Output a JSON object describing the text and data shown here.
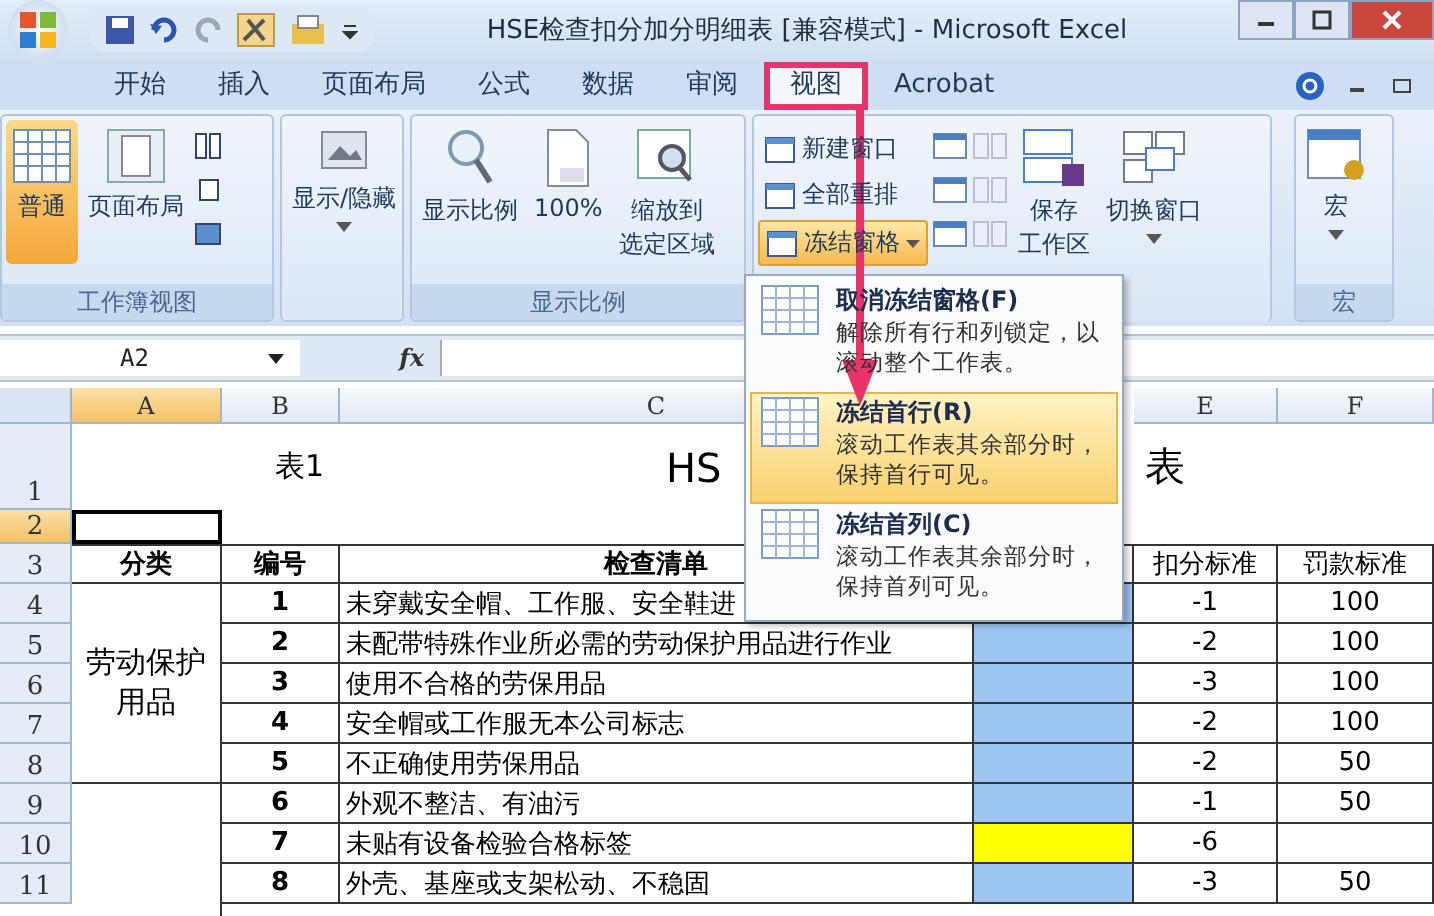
{
  "window": {
    "title": "HSE检查扣分加分明细表 [兼容模式] - Microsoft Excel"
  },
  "tabs": [
    {
      "label": "开始",
      "selected": false
    },
    {
      "label": "插入",
      "selected": false
    },
    {
      "label": "页面布局",
      "selected": false
    },
    {
      "label": "公式",
      "selected": false
    },
    {
      "label": "数据",
      "selected": false
    },
    {
      "label": "审阅",
      "selected": false
    },
    {
      "label": "视图",
      "selected": true
    },
    {
      "label": "Acrobat",
      "selected": false
    }
  ],
  "ribbon": {
    "workbook_views": {
      "label": "工作簿视图",
      "buttons": [
        {
          "label": "普通",
          "selected": true
        },
        {
          "label": "页面布局",
          "selected": false
        }
      ]
    },
    "show_hide": {
      "label": "显示/隐藏"
    },
    "zoom": {
      "label": "显示比例",
      "buttons": [
        {
          "lines": [
            "显示比例"
          ]
        },
        {
          "lines": [
            "100%"
          ]
        },
        {
          "lines": [
            "缩放到",
            "选定区域"
          ]
        }
      ]
    },
    "window_group": {
      "small": [
        {
          "label": "新建窗口",
          "expanded": false
        },
        {
          "label": "全部重排",
          "expanded": false
        },
        {
          "label": "冻结窗格",
          "expanded": true
        }
      ],
      "big": [
        {
          "lines": [
            "保存",
            "工作区"
          ]
        },
        {
          "lines": [
            "切换窗口"
          ]
        }
      ]
    },
    "macros": {
      "label": "宏",
      "button": "宏"
    }
  },
  "freeze_menu": {
    "items": [
      {
        "title": "取消冻结窗格(F)",
        "description": "解除所有行和列锁定，以滚动整个工作表。",
        "selected": false
      },
      {
        "title": "冻结首行(R)",
        "description": "滚动工作表其余部分时，保持首行可见。",
        "selected": true
      },
      {
        "title": "冻结首列(C)",
        "description": "滚动工作表其余部分时，保持首列可见。",
        "selected": false
      }
    ]
  },
  "formula_bar": {
    "name_box": "A2",
    "function_label": "fx"
  },
  "sheet": {
    "columns": [
      {
        "label": "A",
        "selected": true
      },
      {
        "label": "B",
        "selected": false
      },
      {
        "label": "C",
        "selected": false
      },
      {
        "label": "E",
        "selected": false
      },
      {
        "label": "F",
        "selected": false
      }
    ],
    "rows": [
      {
        "label": "1",
        "selected": false
      },
      {
        "label": "2",
        "selected": true
      },
      {
        "label": "3",
        "selected": false
      },
      {
        "label": "4",
        "selected": false
      },
      {
        "label": "5",
        "selected": false
      },
      {
        "label": "6",
        "selected": false
      },
      {
        "label": "7",
        "selected": false
      },
      {
        "label": "8",
        "selected": false
      },
      {
        "label": "9",
        "selected": false
      },
      {
        "label": "10",
        "selected": false
      },
      {
        "label": "11",
        "selected": false
      }
    ],
    "title_row": {
      "left": "表1",
      "title_start": "HS",
      "title_end": "表"
    },
    "header_row": {
      "category": "分类",
      "number": "编号",
      "checklist": "检查清单",
      "deduction": "扣分标准",
      "fine": "罚款标准"
    },
    "categories": [
      {
        "text": "劳动保护用品"
      }
    ],
    "items": [
      {
        "number": "1",
        "check": "未穿戴安全帽、工作服、安全鞋进",
        "color": "#9cc6f2",
        "deduction": "-1",
        "fine": "100"
      },
      {
        "number": "2",
        "check": "未配带特殊作业所必需的劳动保护用品进行作业",
        "color": "#9cc6f2",
        "deduction": "-2",
        "fine": "100"
      },
      {
        "number": "3",
        "check": "使用不合格的劳保用品",
        "color": "#9cc6f2",
        "deduction": "-3",
        "fine": "100"
      },
      {
        "number": "4",
        "check": "安全帽或工作服无本公司标志",
        "color": "#9cc6f2",
        "deduction": "-2",
        "fine": "100"
      },
      {
        "number": "5",
        "check": "不正确使用劳保用品",
        "color": "#9cc6f2",
        "deduction": "-2",
        "fine": "50"
      },
      {
        "number": "6",
        "check": "外观不整洁、有油污",
        "color": "#9cc6f2",
        "deduction": "-1",
        "fine": "50"
      },
      {
        "number": "7",
        "check": "未贴有设备检验合格标签",
        "color": "#ffff00",
        "deduction": "-6"
      },
      {
        "number": "8",
        "check": "外壳、基座或支架松动、不稳固",
        "color": "#9cc6f2",
        "deduction": "-3",
        "fine": "50"
      }
    ]
  }
}
